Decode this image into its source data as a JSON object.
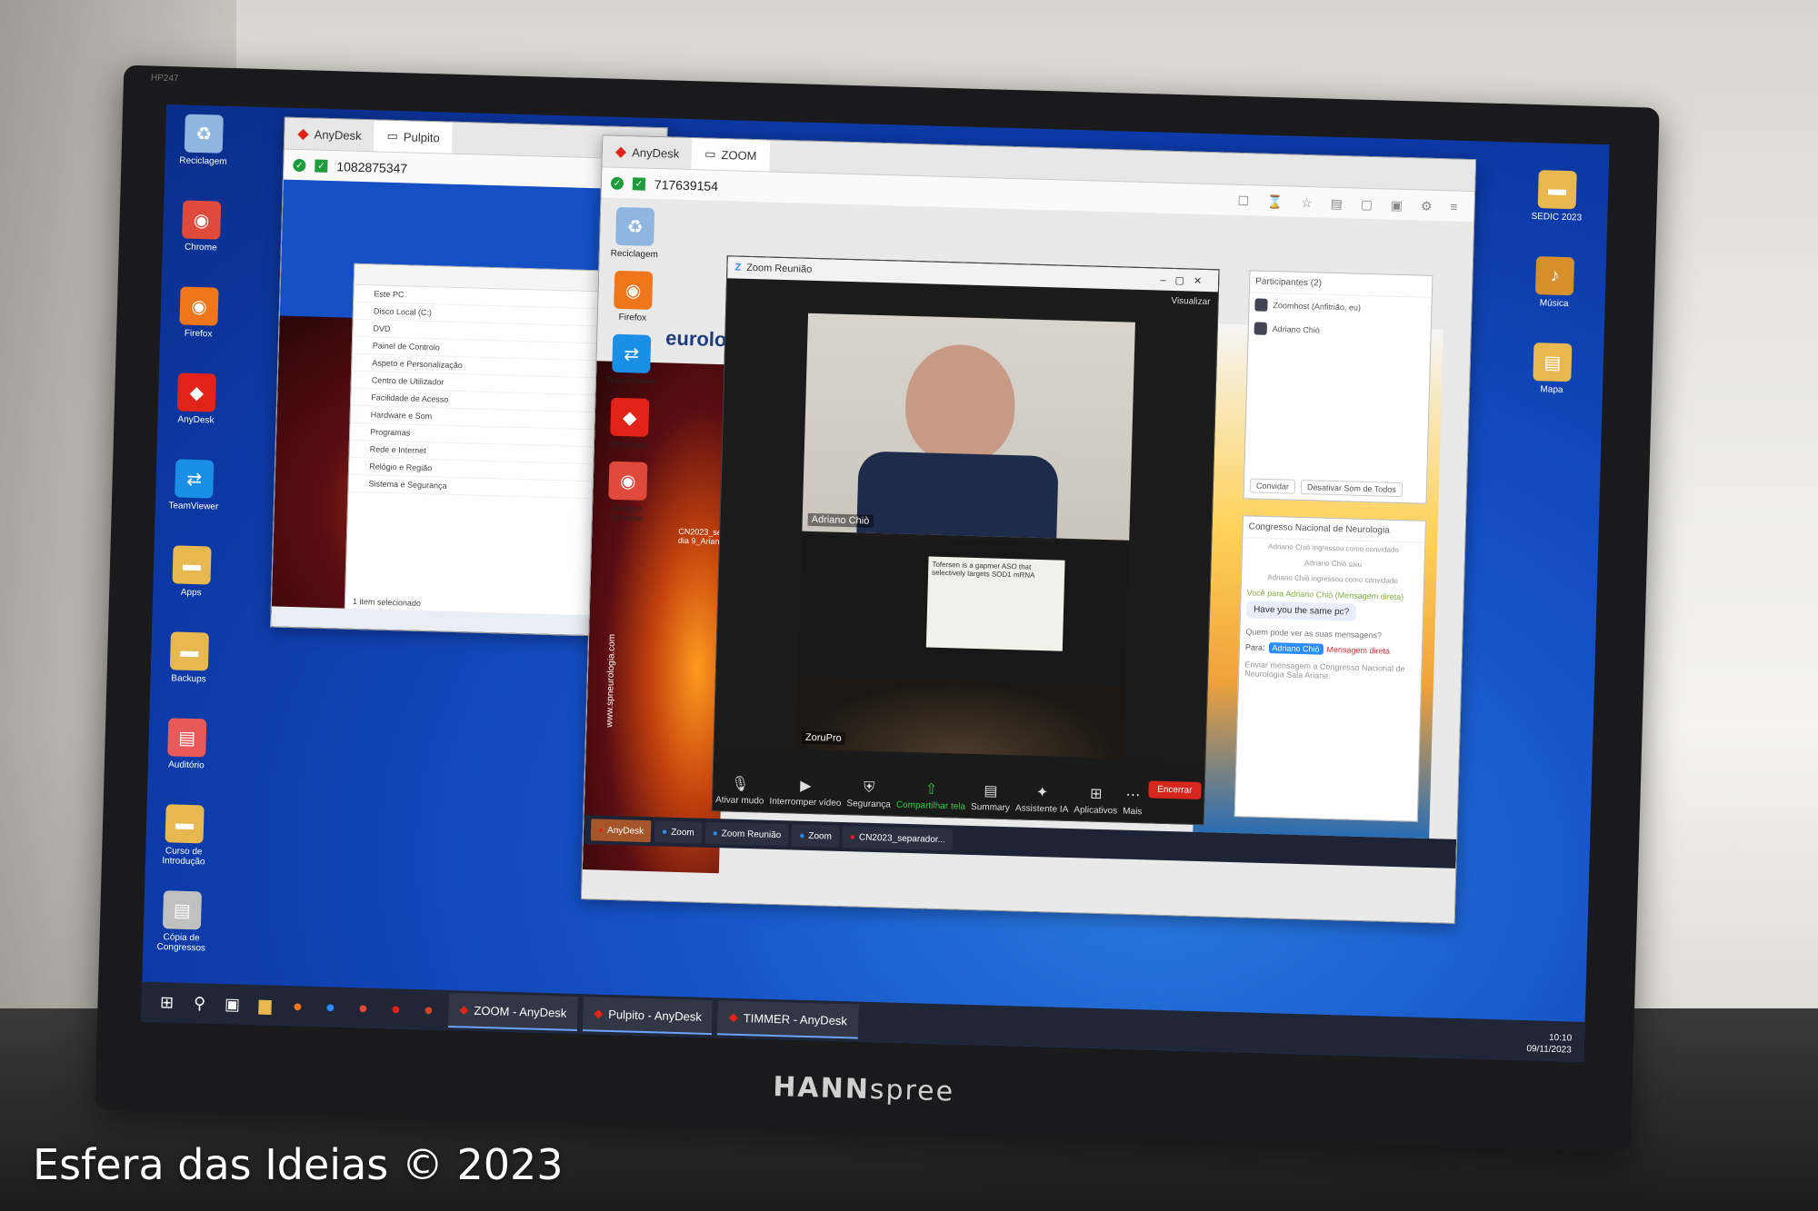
{
  "monitor": {
    "model": "HP247",
    "brand_light": "HANN",
    "brand_dark": "spree"
  },
  "desktop": {
    "icons_left": [
      {
        "label": "Reciclagem",
        "icon": "recycle-bin-icon",
        "color": "#8fb6e0"
      },
      {
        "label": "Chrome",
        "icon": "chrome-icon",
        "color": "#e04a3a"
      },
      {
        "label": "Firefox",
        "icon": "firefox-icon",
        "color": "#f0761c"
      },
      {
        "label": "AnyDesk",
        "icon": "anydesk-icon",
        "color": "#e2231a"
      },
      {
        "label": "TeamViewer",
        "icon": "teamviewer-icon",
        "color": "#1a8fe8"
      },
      {
        "label": "Apps",
        "icon": "folder-icon",
        "color": "#e6b84f"
      },
      {
        "label": "Backups",
        "icon": "folder-icon",
        "color": "#e6b84f"
      },
      {
        "label": "Auditório",
        "icon": "file-icon",
        "color": "#e85a5a"
      },
      {
        "label": "Curso de Introdução",
        "icon": "folder-icon",
        "color": "#e6b84f"
      },
      {
        "label": "Cópia de Congressos",
        "icon": "file-icon",
        "color": "#c0c0c0"
      }
    ],
    "icons_right": [
      {
        "label": "SEDIC 2023",
        "icon": "folder-icon",
        "color": "#e6b84f"
      },
      {
        "label": "Música",
        "icon": "music-icon",
        "color": "#d78f2c"
      },
      {
        "label": "Mapa",
        "icon": "file-icon",
        "color": "#e6b84f"
      }
    ]
  },
  "anydesk_pulpito": {
    "app": "AnyDesk",
    "tab": "Pulpito",
    "address": "1082875347",
    "explorer_rows": [
      "Este PC",
      "Disco Local (C:)",
      "DVD",
      "Painel de Controlo",
      "Aspeto e Personalização",
      "Centro de Utilizador",
      "Facilidade de Acesso",
      "Hardware e Som",
      "Programas",
      "Rede e Internet",
      "Relógio e Região",
      "Sistema e Segurança"
    ],
    "explorer_status": "1 item selecionado"
  },
  "anydesk_zoom": {
    "app": "AnyDesk",
    "tab": "ZOOM",
    "address": "717639154"
  },
  "remote_desktop": {
    "icons": [
      {
        "label": "Reciclagem",
        "icon": "recycle-bin-icon",
        "color": "#8fb6e0"
      },
      {
        "label": "Firefox",
        "icon": "firefox-icon",
        "color": "#f0761c"
      },
      {
        "label": "TeamViewer",
        "icon": "teamviewer-icon",
        "color": "#1a8fe8"
      },
      {
        "label": "AnyDesk",
        "icon": "anydesk-icon",
        "color": "#e2231a"
      },
      {
        "label": "Google Chrome",
        "icon": "chrome-icon",
        "color": "#e04a3a"
      }
    ],
    "poster_text": "www.spneurologia.com",
    "poster_fragment": "eurolo",
    "poster_file": "CN2023_separador dia 9_Arian..."
  },
  "zoom_window": {
    "title": "Zoom Reunião",
    "view_label": "Visualizar",
    "speaker_name": "Adriano Chiò",
    "room_name": "ZoruPro",
    "slide_text": "Tofersen is a gapmer ASO that selectively targets SOD1 mRNA",
    "controls": [
      {
        "label": "Ativar mudo",
        "icon": "microphone-icon"
      },
      {
        "label": "Interromper vídeo",
        "icon": "video-icon"
      },
      {
        "label": "Segurança",
        "icon": "shield-icon"
      },
      {
        "label": "Compartilhar tela",
        "icon": "share-screen-icon"
      },
      {
        "label": "Summary",
        "icon": "summary-icon"
      },
      {
        "label": "Assistente IA",
        "icon": "ai-assistant-icon"
      },
      {
        "label": "Aplicativos",
        "icon": "apps-icon"
      },
      {
        "label": "Mais",
        "icon": "more-icon"
      }
    ],
    "end_label": "Encerrar",
    "share_color": "#2ecc4a"
  },
  "participants_panel": {
    "title": "Participantes (2)",
    "people": [
      "Zoomhost (Anfitrião, eu)",
      "Adriano Chiò"
    ],
    "buttons": [
      "Convidar",
      "Desativar Som de Todos"
    ]
  },
  "chat_panel": {
    "title": "Congresso Nacional de Neurologia",
    "system_lines": [
      "Adriano Chiò ingressou como convidado",
      "Adriano Chiò saiu",
      "Adriano Chiò ingressou como convidado"
    ],
    "direct_to": "Você para Adriano Chiò (Mensagem direta)",
    "message": "Have you the same pc?",
    "recipient_label": "Para:",
    "recipient": "Adriano Chiò",
    "direct_label": "Mensagem direta",
    "placeholder": "Enviar mensagem a Congresso Nacional de Neurologia Sala Ariane",
    "who_sees": "Quem pode ver as suas mensagens?"
  },
  "inner_taskbar": [
    {
      "label": "AnyDesk",
      "color": "#e2231a"
    },
    {
      "label": "Zoom",
      "color": "#2d8cff"
    },
    {
      "label": "Zoom Reunião",
      "color": "#2d8cff"
    },
    {
      "label": "Zoom",
      "color": "#2d8cff"
    },
    {
      "label": "CN2023_separador...",
      "color": "#e2231a"
    }
  ],
  "taskbar": {
    "apps": [
      {
        "label": "ZOOM - AnyDesk"
      },
      {
        "label": "Pulpito - AnyDesk"
      },
      {
        "label": "TIMMER - AnyDesk"
      }
    ],
    "tray_time": "10:10",
    "tray_date": "09/11/2023"
  },
  "watermark": "Esfera das Ideias © 2023"
}
